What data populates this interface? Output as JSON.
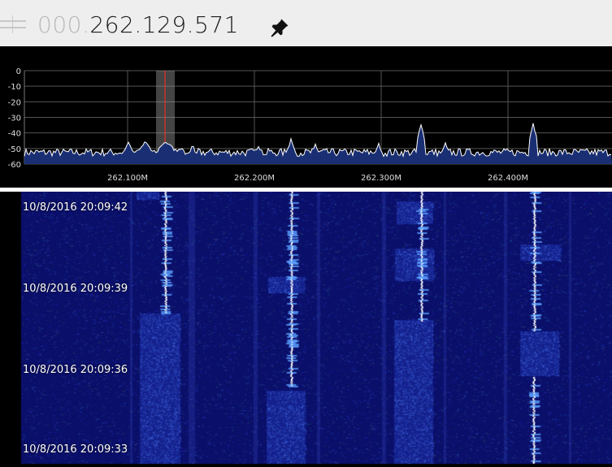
{
  "header": {
    "freq_dim": "000.",
    "freq_main": "262.129.571"
  },
  "spectrum": {
    "y_ticks": [
      "0",
      "-10",
      "-20",
      "-30",
      "-40",
      "-50",
      "-60"
    ],
    "x_ticks": [
      "262.100M",
      "262.200M",
      "262.300M",
      "262.400M"
    ],
    "trace_color": "#ffffff",
    "fill_color": "#1a2f73",
    "marker_color": "#ff2a2a"
  },
  "waterfall": {
    "timestamps": [
      "10/8/2016 20:09:42",
      "10/8/2016 20:09:39",
      "10/8/2016 20:09:36",
      "10/8/2016 20:09:33"
    ],
    "background_color": "#0a0f6a"
  }
}
